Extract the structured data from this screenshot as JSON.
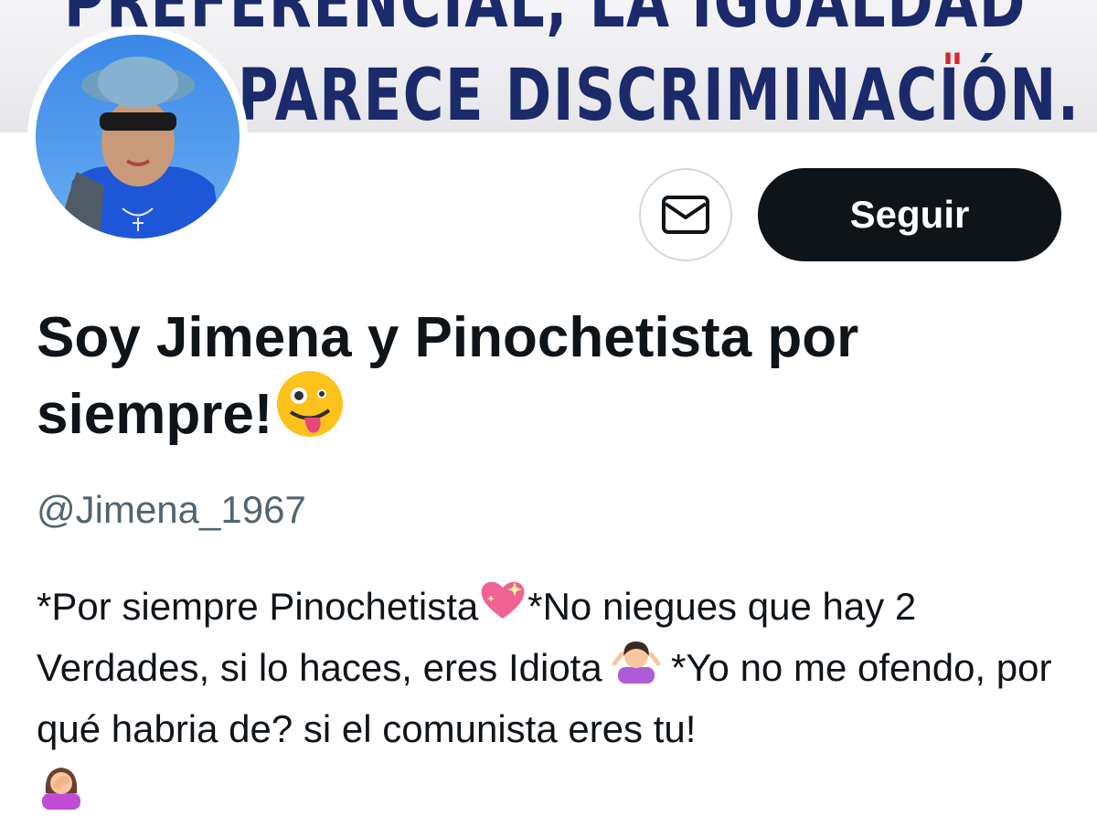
{
  "banner": {
    "line1": "PREFERENCIAL, LA IGUALDAD",
    "line2": "PARECE DISCRIMINACIÓN.",
    "quote_mark": "\""
  },
  "profile": {
    "display_name": "Soy Jimena y Pinochetista por siempre!",
    "display_name_emoji": "zany-face-icon",
    "handle": "@Jimena_1967",
    "bio": {
      "part1": "*Por siempre Pinochetista",
      "part2": "*No niegues que hay 2 Verdades, si lo haces, eres Idiota ",
      "part3": " *Yo no me ofendo, por qué habria de? si el comunista eres tu!"
    }
  },
  "actions": {
    "message_icon": "envelope-icon",
    "follow_label": "Seguir"
  },
  "colors": {
    "text_primary": "#0f1419",
    "text_secondary": "#536471",
    "button_dark": "#0f1419",
    "border": "#cfd9de",
    "banner_text": "#1b2a6b",
    "banner_quote": "#d8262c"
  }
}
